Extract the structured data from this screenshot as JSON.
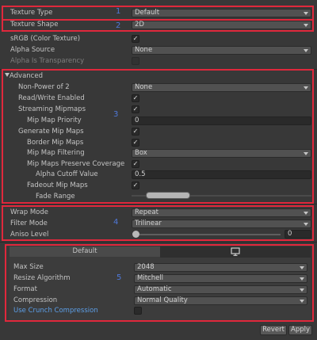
{
  "rows": {
    "texture_type": {
      "label": "Texture Type",
      "value": "Default"
    },
    "texture_shape": {
      "label": "Texture Shape",
      "value": "2D"
    },
    "srgb": {
      "label": "sRGB (Color Texture)",
      "checked": "✓"
    },
    "alpha_source": {
      "label": "Alpha Source",
      "value": "None"
    },
    "alpha_transparency": {
      "label": "Alpha Is Transparency"
    }
  },
  "advanced": {
    "header": "Advanced",
    "non_power_of_2": {
      "label": "Non-Power of 2",
      "value": "None"
    },
    "read_write": {
      "label": "Read/Write Enabled",
      "checked": "✓"
    },
    "streaming_mipmaps": {
      "label": "Streaming Mipmaps",
      "checked": "✓"
    },
    "mip_map_priority": {
      "label": "Mip Map Priority",
      "value": "0"
    },
    "generate_mip_maps": {
      "label": "Generate Mip Maps",
      "checked": "✓"
    },
    "border_mip_maps": {
      "label": "Border Mip Maps",
      "checked": "✓"
    },
    "mip_map_filtering": {
      "label": "Mip Map Filtering",
      "value": "Box"
    },
    "preserve_coverage": {
      "label": "Mip Maps Preserve Coverage",
      "checked": "✓"
    },
    "alpha_cutoff": {
      "label": "Alpha Cutoff Value",
      "value": "0.5"
    },
    "fadeout_mip_maps": {
      "label": "Fadeout Mip Maps",
      "checked": "✓"
    },
    "fade_range": {
      "label": "Fade Range"
    }
  },
  "wrap": {
    "wrap_mode": {
      "label": "Wrap Mode",
      "value": "Repeat"
    },
    "filter_mode": {
      "label": "Filter Mode",
      "value": "Trilinear"
    },
    "aniso_level": {
      "label": "Aniso Level",
      "value": "0",
      "level": 0
    }
  },
  "platform": {
    "tab_default": "Default",
    "monitor_icon": "monitor-icon",
    "max_size": {
      "label": "Max Size",
      "value": "2048"
    },
    "resize_algorithm": {
      "label": "Resize Algorithm",
      "value": "Mitchell"
    },
    "format": {
      "label": "Format",
      "value": "Automatic"
    },
    "compression": {
      "label": "Compression",
      "value": "Normal Quality"
    },
    "crunch": {
      "label": "Use Crunch Compression"
    }
  },
  "markers": [
    "1",
    "2",
    "3",
    "4",
    "5"
  ],
  "buttons": {
    "revert": "Revert",
    "apply": "Apply"
  },
  "colors": {
    "highlight_box": "#e0283c",
    "marker": "#4f78d8",
    "link_label": "#5c9fe8"
  }
}
